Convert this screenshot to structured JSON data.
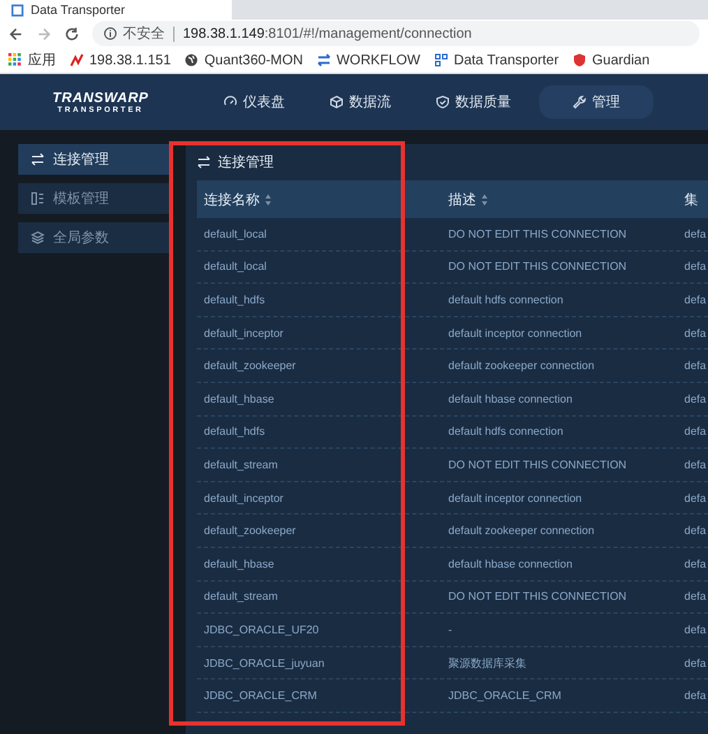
{
  "browser": {
    "tab_title": "Data Transporter",
    "security": "不安全",
    "url_host": "198.38.1.149",
    "url_rest": ":8101/#!/management/connection"
  },
  "bookmarks": [
    {
      "kind": "apps",
      "label": "应用"
    },
    {
      "kind": "chart",
      "label": "198.38.1.151"
    },
    {
      "kind": "globe",
      "label": "Quant360-MON"
    },
    {
      "kind": "arrows",
      "label": "WORKFLOW"
    },
    {
      "kind": "grid",
      "label": "Data Transporter"
    },
    {
      "kind": "shield",
      "label": "Guardian"
    }
  ],
  "app": {
    "logo_top": "TRANSWARP",
    "logo_bottom": "TRANSPORTER"
  },
  "nav": [
    {
      "kind": "gauge",
      "label": "仪表盘",
      "selected": false
    },
    {
      "kind": "cube",
      "label": "数据流",
      "selected": false
    },
    {
      "kind": "shield",
      "label": "数据质量",
      "selected": false
    },
    {
      "kind": "wrench",
      "label": "管理",
      "selected": true
    }
  ],
  "sidebar": [
    {
      "kind": "swap",
      "label": "连接管理",
      "selected": true
    },
    {
      "kind": "template",
      "label": "模板管理",
      "selected": false
    },
    {
      "kind": "layers",
      "label": "全局参数",
      "selected": false
    }
  ],
  "panel": {
    "title": "连接管理"
  },
  "table": {
    "columns": [
      {
        "label": "连接名称",
        "sortable": true
      },
      {
        "label": "描述",
        "sortable": true
      },
      {
        "label": "集",
        "sortable": false
      }
    ],
    "rows": [
      [
        "default_local",
        "DO NOT EDIT THIS CONNECTION",
        "defa"
      ],
      [
        "default_local",
        "DO NOT EDIT THIS CONNECTION",
        "defa"
      ],
      [
        "default_hdfs",
        "default hdfs connection",
        "defa"
      ],
      [
        "default_inceptor",
        "default inceptor connection",
        "defa"
      ],
      [
        "default_zookeeper",
        "default zookeeper connection",
        "defa"
      ],
      [
        "default_hbase",
        "default hbase connection",
        "defa"
      ],
      [
        "default_hdfs",
        "default hdfs connection",
        "defa"
      ],
      [
        "default_stream",
        "DO NOT EDIT THIS CONNECTION",
        "defa"
      ],
      [
        "default_inceptor",
        "default inceptor connection",
        "defa"
      ],
      [
        "default_zookeeper",
        "default zookeeper connection",
        "defa"
      ],
      [
        "default_hbase",
        "default hbase connection",
        "defa"
      ],
      [
        "default_stream",
        "DO NOT EDIT THIS CONNECTION",
        "defa"
      ],
      [
        "JDBC_ORACLE_UF20",
        "-",
        "defa"
      ],
      [
        "JDBC_ORACLE_juyuan",
        "聚源数据库采集",
        "defa"
      ],
      [
        "JDBC_ORACLE_CRM",
        "JDBC_ORACLE_CRM",
        "defa"
      ]
    ]
  },
  "annotation": {
    "kind": "highlight-box"
  }
}
